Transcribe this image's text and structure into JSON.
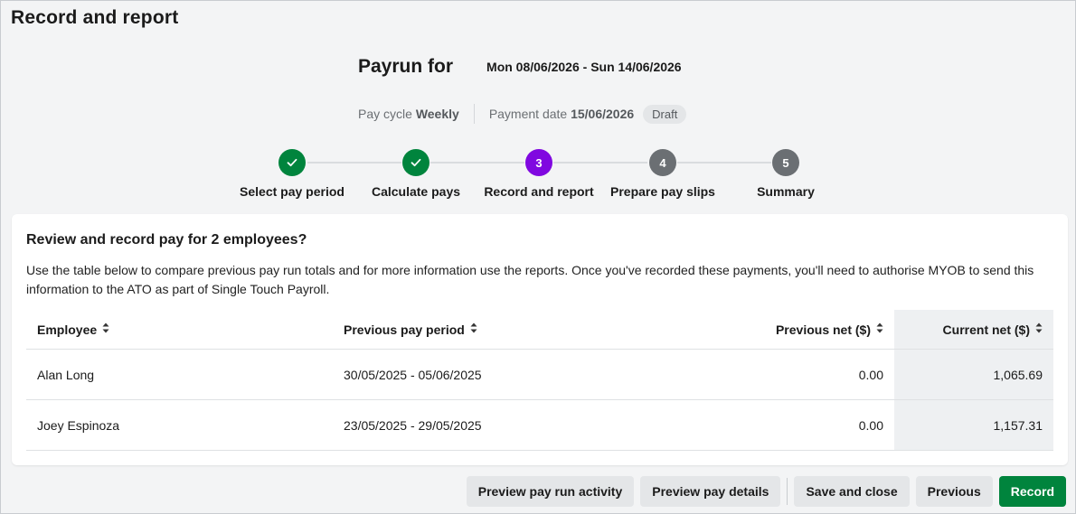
{
  "page": {
    "title": "Record and report"
  },
  "payrun": {
    "heading": "Payrun for",
    "dates": "Mon 08/06/2026 - Sun 14/06/2026",
    "pay_cycle_label": "Pay cycle",
    "pay_cycle_value": "Weekly",
    "payment_date_label": "Payment date",
    "payment_date_value": "15/06/2026",
    "status_badge": "Draft"
  },
  "stepper": {
    "steps": [
      {
        "number": "1",
        "label": "Select pay period",
        "state": "done"
      },
      {
        "number": "2",
        "label": "Calculate pays",
        "state": "done"
      },
      {
        "number": "3",
        "label": "Record and report",
        "state": "current"
      },
      {
        "number": "4",
        "label": "Prepare pay slips",
        "state": "todo"
      },
      {
        "number": "5",
        "label": "Summary",
        "state": "todo"
      }
    ],
    "check_icon": "check-icon",
    "colors": {
      "done": "#00843d",
      "current": "#8008e0",
      "todo": "#6b6f73"
    }
  },
  "card": {
    "title": "Review and record pay for 2 employees?",
    "description": "Use the table below to compare previous pay run totals and for more information use the reports. Once you've recorded these payments, you'll need to authorise MYOB to send this information to the ATO as part of Single Touch Payroll."
  },
  "table": {
    "columns": [
      "Employee",
      "Previous pay period",
      "Previous net ($)",
      "Current net ($)"
    ],
    "sort_icon": "sort-icon",
    "rows": [
      {
        "employee": "Alan Long",
        "previous_period": "30/05/2025 - 05/06/2025",
        "previous_net": "0.00",
        "current_net": "1,065.69"
      },
      {
        "employee": "Joey Espinoza",
        "previous_period": "23/05/2025 - 29/05/2025",
        "previous_net": "0.00",
        "current_net": "1,157.31"
      }
    ]
  },
  "footer": {
    "preview_activity": "Preview pay run activity",
    "preview_details": "Preview pay details",
    "save_close": "Save and close",
    "previous": "Previous",
    "record": "Record"
  },
  "colors": {
    "primary": "#00843d",
    "current_step": "#8008e0"
  }
}
